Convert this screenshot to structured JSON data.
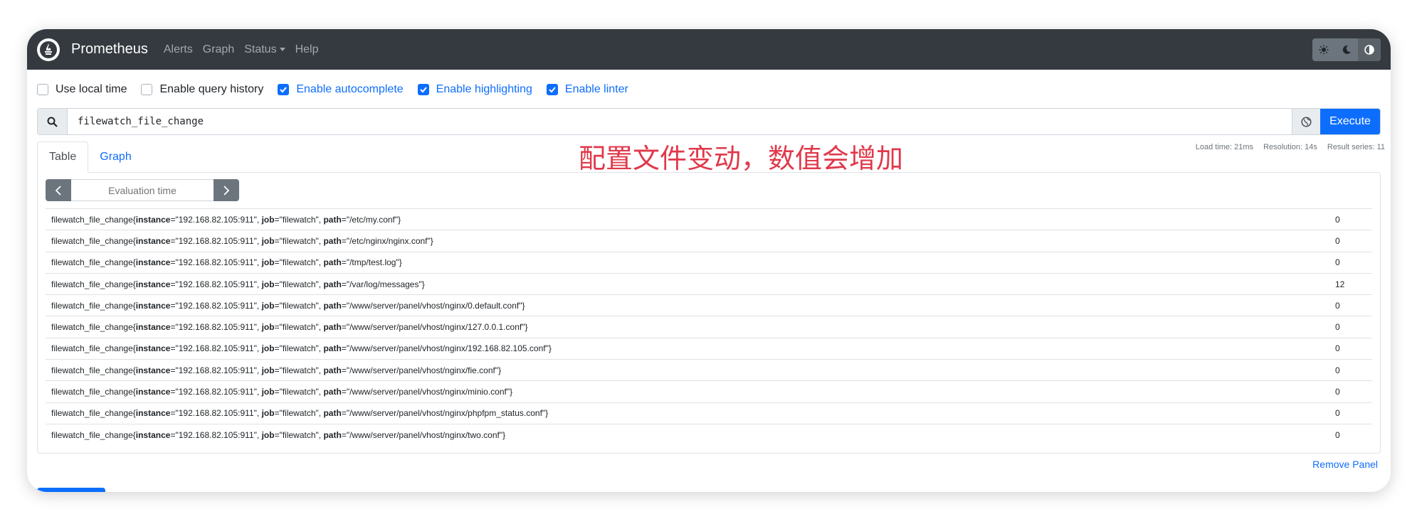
{
  "navbar": {
    "brand": "Prometheus",
    "links": [
      "Alerts",
      "Graph",
      "Status",
      "Help"
    ]
  },
  "options": [
    {
      "label": "Use local time",
      "checked": false
    },
    {
      "label": "Enable query history",
      "checked": false
    },
    {
      "label": "Enable autocomplete",
      "checked": true
    },
    {
      "label": "Enable highlighting",
      "checked": true
    },
    {
      "label": "Enable linter",
      "checked": true
    }
  ],
  "query": {
    "value": "filewatch_file_change",
    "execute_label": "Execute"
  },
  "tabs": [
    "Table",
    "Graph"
  ],
  "stats": {
    "load_time": "Load time: 21ms",
    "resolution": "Resolution: 14s",
    "result_series": "Result series: 11"
  },
  "annotation": "配置文件变动，数值会增加",
  "eval_time": {
    "placeholder": "Evaluation time"
  },
  "metric": "filewatch_file_change",
  "rows": [
    {
      "instance": "192.168.82.105:911",
      "job": "filewatch",
      "path": "/etc/my.conf",
      "value": "0"
    },
    {
      "instance": "192.168.82.105:911",
      "job": "filewatch",
      "path": "/etc/nginx/nginx.conf",
      "value": "0"
    },
    {
      "instance": "192.168.82.105:911",
      "job": "filewatch",
      "path": "/tmp/test.log",
      "value": "0"
    },
    {
      "instance": "192.168.82.105:911",
      "job": "filewatch",
      "path": "/var/log/messages",
      "value": "12"
    },
    {
      "instance": "192.168.82.105:911",
      "job": "filewatch",
      "path": "/www/server/panel/vhost/nginx/0.default.conf",
      "value": "0"
    },
    {
      "instance": "192.168.82.105:911",
      "job": "filewatch",
      "path": "/www/server/panel/vhost/nginx/127.0.0.1.conf",
      "value": "0"
    },
    {
      "instance": "192.168.82.105:911",
      "job": "filewatch",
      "path": "/www/server/panel/vhost/nginx/192.168.82.105.conf",
      "value": "0"
    },
    {
      "instance": "192.168.82.105:911",
      "job": "filewatch",
      "path": "/www/server/panel/vhost/nginx/fie.conf",
      "value": "0"
    },
    {
      "instance": "192.168.82.105:911",
      "job": "filewatch",
      "path": "/www/server/panel/vhost/nginx/minio.conf",
      "value": "0"
    },
    {
      "instance": "192.168.82.105:911",
      "job": "filewatch",
      "path": "/www/server/panel/vhost/nginx/phpfpm_status.conf",
      "value": "0"
    },
    {
      "instance": "192.168.82.105:911",
      "job": "filewatch",
      "path": "/www/server/panel/vhost/nginx/two.conf",
      "value": "0"
    }
  ],
  "remove_label": "Remove Panel",
  "colors": {
    "accent": "#0d6efd",
    "navbar": "#343a40",
    "annotation": "#e0394b"
  }
}
